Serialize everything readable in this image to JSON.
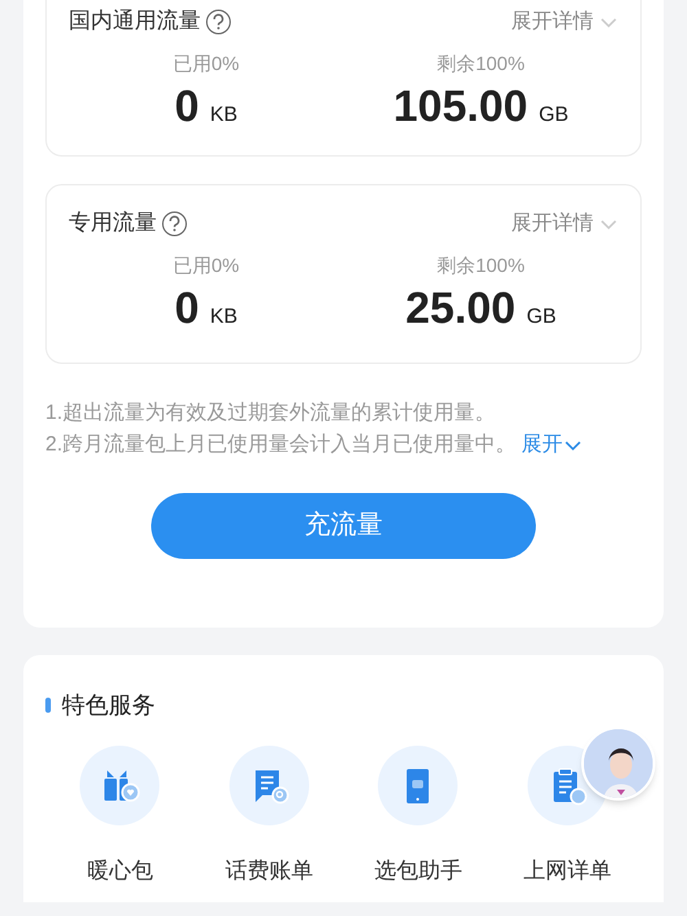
{
  "usage_cards": [
    {
      "title": "国内通用流量",
      "details_link": "展开详情",
      "used_label": "已用0%",
      "used_value": "0",
      "used_unit": "KB",
      "remaining_label": "剩余100%",
      "remaining_value": "105.00",
      "remaining_unit": "GB"
    },
    {
      "title": "专用流量",
      "details_link": "展开详情",
      "used_label": "已用0%",
      "used_value": "0",
      "used_unit": "KB",
      "remaining_label": "剩余100%",
      "remaining_value": "25.00",
      "remaining_unit": "GB"
    }
  ],
  "notes": [
    "1.超出流量为有效及过期套外流量的累计使用量。",
    "2.跨月流量包上月已使用量会计入当月已使用量中。"
  ],
  "notes_expand": "展开",
  "recharge_button": "充流量",
  "services": {
    "title": "特色服务",
    "items": [
      {
        "label": "暖心包",
        "kind": "gift"
      },
      {
        "label": "话费账单",
        "kind": "bill"
      },
      {
        "label": "选包助手",
        "kind": "phone"
      },
      {
        "label": "上网详单",
        "kind": "clipboard"
      }
    ]
  }
}
